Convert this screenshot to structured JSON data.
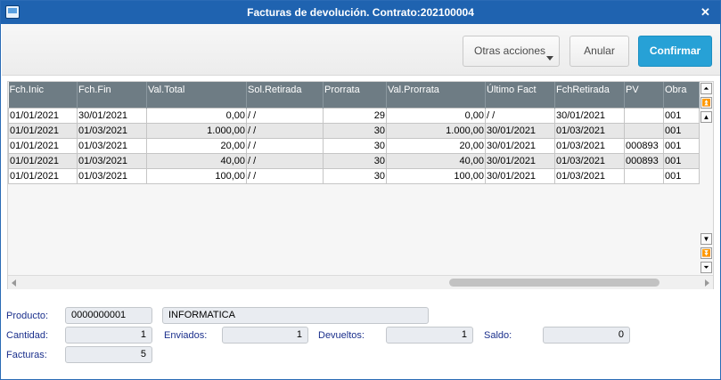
{
  "window": {
    "title": "Facturas de devolución. Contrato:202100004",
    "icon": "window-app-icon",
    "close_label": "✕"
  },
  "toolbar": {
    "otras_label": "Otras acciones",
    "anular_label": "Anular",
    "confirmar_label": "Confirmar",
    "confirmar_color": "#27a1d6"
  },
  "grid": {
    "header_color": "#6e7c84",
    "columns": [
      "Fch.Inic",
      "Fch.Fin",
      "Val.Total",
      "Sol.Retirada",
      "Prorrata",
      "Val.Prorrata",
      "Último Fact",
      "FchRetirada",
      "PV",
      "Obra"
    ],
    "rows": [
      [
        "01/01/2021",
        "30/01/2021",
        "0,00",
        " / /",
        "29",
        "0,00",
        " / /",
        "30/01/2021",
        "",
        "001"
      ],
      [
        "01/01/2021",
        "01/03/2021",
        "1.000,00",
        " / /",
        "30",
        "1.000,00",
        "30/01/2021",
        "01/03/2021",
        "",
        "001"
      ],
      [
        "01/01/2021",
        "01/03/2021",
        "20,00",
        " / /",
        "30",
        "20,00",
        "30/01/2021",
        "01/03/2021",
        "000893",
        "001"
      ],
      [
        "01/01/2021",
        "01/03/2021",
        "40,00",
        " / /",
        "30",
        "40,00",
        "30/01/2021",
        "01/03/2021",
        "000893",
        "001"
      ],
      [
        "01/01/2021",
        "01/03/2021",
        "100,00",
        " / /",
        "30",
        "100,00",
        "30/01/2021",
        "01/03/2021",
        "",
        "001"
      ]
    ]
  },
  "scroll": {
    "top_icon": "⏶",
    "page_up_icon": "⏫",
    "up_icon": "▲",
    "down_icon": "▼",
    "page_down_icon": "⏬",
    "bottom_icon": "⏷"
  },
  "footer": {
    "producto_label": "Producto:",
    "producto_code": "0000000001",
    "producto_name": "INFORMATICA",
    "cantidad_label": "Cantidad:",
    "cantidad_value": "1",
    "enviados_label": "Enviados:",
    "enviados_value": "1",
    "devueltos_label": "Devueltos:",
    "devueltos_value": "1",
    "saldo_label": "Saldo:",
    "saldo_value": "0",
    "facturas_label": "Facturas:",
    "facturas_value": "5"
  }
}
